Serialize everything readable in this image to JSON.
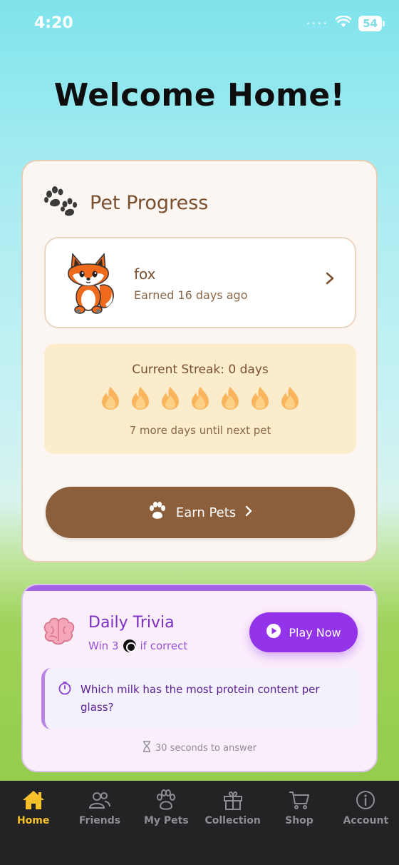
{
  "status_bar": {
    "time": "4:20",
    "battery": "54"
  },
  "page_title": "Welcome Home!",
  "pet_progress": {
    "title": "Pet Progress",
    "pet": {
      "name": "fox",
      "earned": "Earned 16 days ago"
    },
    "streak": {
      "title": "Current Streak: 0 days",
      "flame_count": 7,
      "subtitle": "7 more days until next pet"
    },
    "earn_button": "Earn Pets"
  },
  "trivia": {
    "title": "Daily Trivia",
    "win_prefix": "Win 3",
    "win_suffix": "if correct",
    "play_button": "Play Now",
    "question": "Which milk has the most protein content per glass?",
    "timer": "30 seconds to answer"
  },
  "tabs": [
    {
      "label": "Home",
      "icon": "home-icon",
      "active": true
    },
    {
      "label": "Friends",
      "icon": "friends-icon",
      "active": false
    },
    {
      "label": "My Pets",
      "icon": "paw-icon",
      "active": false
    },
    {
      "label": "Collection",
      "icon": "gift-icon",
      "active": false
    },
    {
      "label": "Shop",
      "icon": "cart-icon",
      "active": false
    },
    {
      "label": "Account",
      "icon": "info-icon",
      "active": false
    }
  ],
  "colors": {
    "brown": "#8b5e3c",
    "purple": "#9333ea",
    "tab_active": "#f5c02c"
  }
}
